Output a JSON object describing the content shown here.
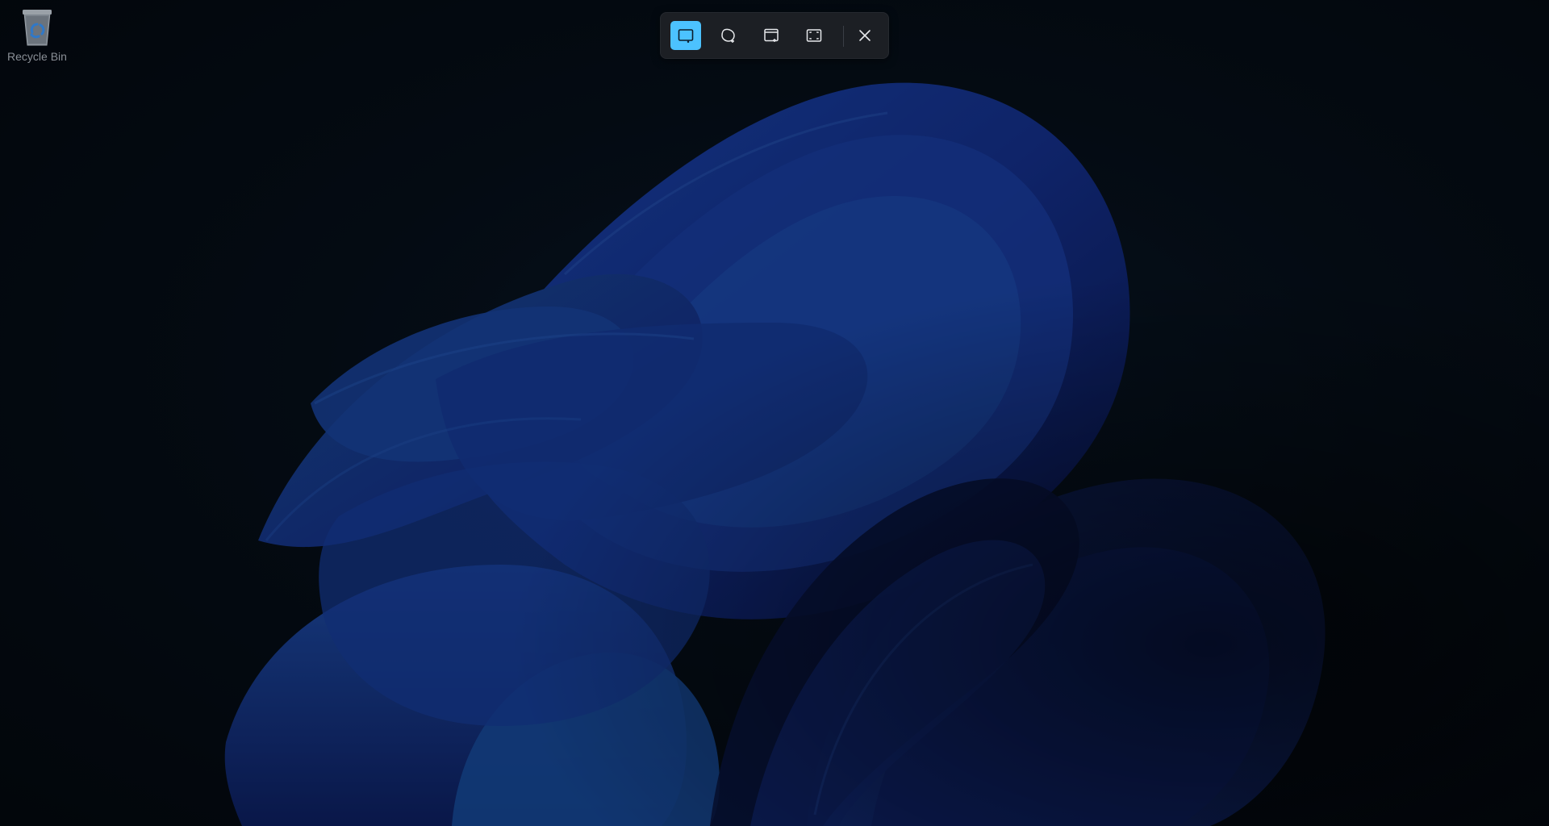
{
  "desktop": {
    "icons": [
      {
        "label": "Recycle Bin",
        "icon": "recycle-bin-icon"
      }
    ]
  },
  "snipping_toolbar": {
    "modes": [
      {
        "name": "rectangle-mode",
        "icon": "rectangle-snip-icon",
        "selected": true
      },
      {
        "name": "freeform-mode",
        "icon": "freeform-snip-icon",
        "selected": false
      },
      {
        "name": "window-mode",
        "icon": "window-snip-icon",
        "selected": false
      },
      {
        "name": "fullscreen-mode",
        "icon": "fullscreen-snip-icon",
        "selected": false
      }
    ],
    "close_icon": "close-icon"
  },
  "colors": {
    "accent": "#4cc2ff",
    "toolbar_bg": "#1c1f24",
    "wallpaper_blue": "#1a3aa0",
    "background": "#050b12"
  }
}
